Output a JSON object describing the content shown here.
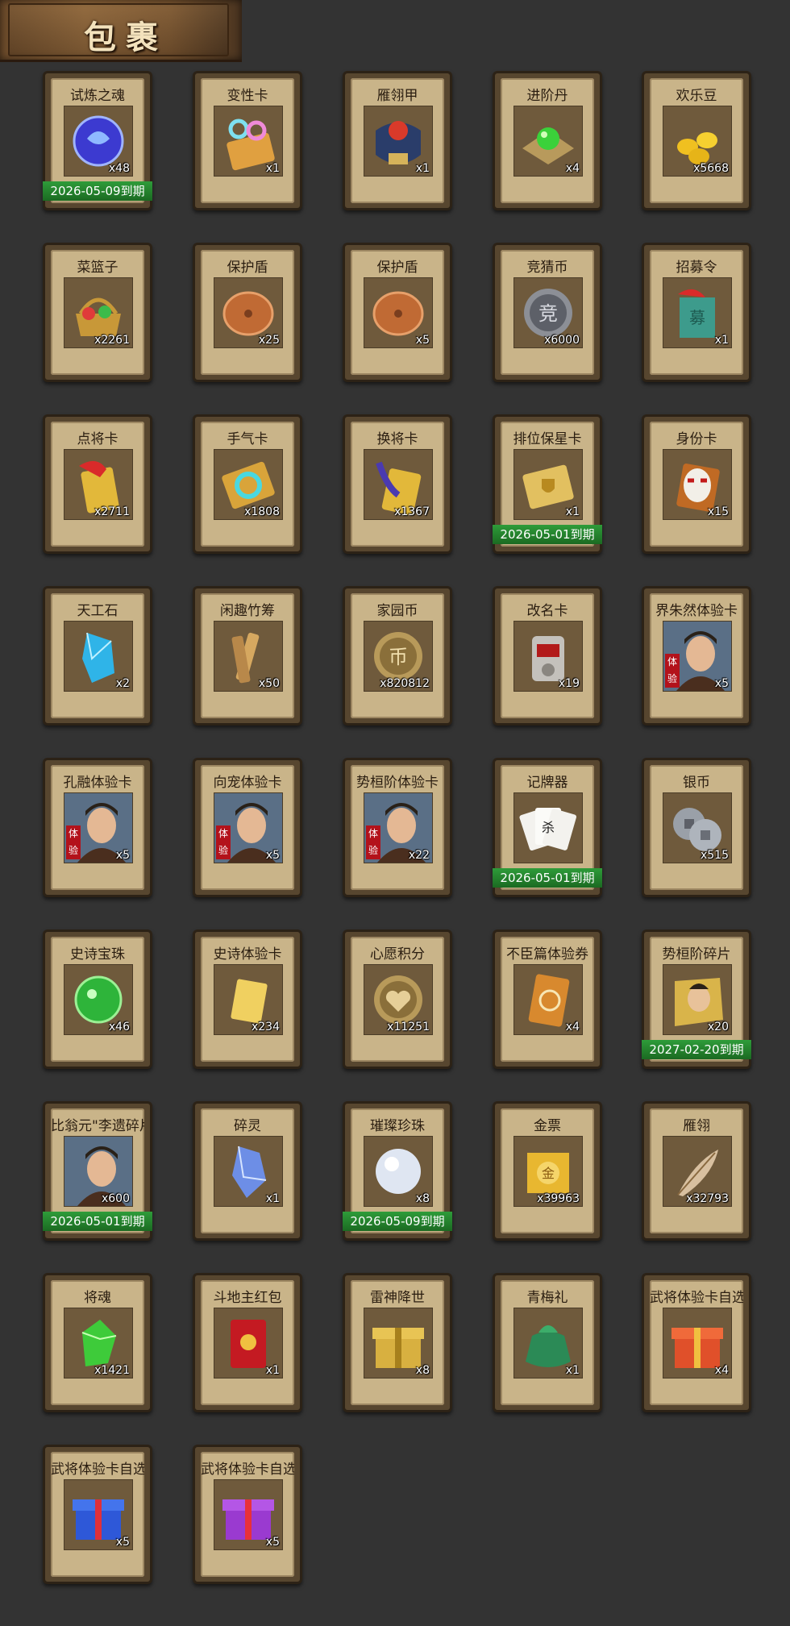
{
  "header": {
    "title": "包裹"
  },
  "items": [
    {
      "name": "试炼之魂",
      "count": "x48",
      "expiry": "2026-05-09到期",
      "icon": "blue-orb-icon"
    },
    {
      "name": "变性卡",
      "count": "x1",
      "expiry": "",
      "icon": "gender-card-icon"
    },
    {
      "name": "雁翎甲",
      "count": "x1",
      "expiry": "",
      "icon": "armor-icon"
    },
    {
      "name": "进阶丹",
      "count": "x4",
      "expiry": "",
      "icon": "green-pill-icon"
    },
    {
      "name": "欢乐豆",
      "count": "x5668",
      "expiry": "",
      "icon": "gold-beans-icon"
    },
    {
      "name": "菜篮子",
      "count": "x2261",
      "expiry": "",
      "icon": "basket-icon"
    },
    {
      "name": "保护盾",
      "count": "x25",
      "expiry": "",
      "icon": "shield-icon"
    },
    {
      "name": "保护盾",
      "count": "x5",
      "expiry": "",
      "icon": "shield-icon"
    },
    {
      "name": "竞猜币",
      "count": "x6000",
      "expiry": "",
      "icon": "silver-coin-icon"
    },
    {
      "name": "招募令",
      "count": "x1",
      "expiry": "",
      "icon": "jade-token-icon"
    },
    {
      "name": "点将卡",
      "count": "x2711",
      "expiry": "",
      "icon": "general-card-icon"
    },
    {
      "name": "手气卡",
      "count": "x1808",
      "expiry": "",
      "icon": "luck-card-icon"
    },
    {
      "name": "换将卡",
      "count": "x1367",
      "expiry": "",
      "icon": "swap-card-icon"
    },
    {
      "name": "排位保星卡",
      "count": "x1",
      "expiry": "2026-05-01到期",
      "icon": "rank-card-icon"
    },
    {
      "name": "身份卡",
      "count": "x15",
      "expiry": "",
      "icon": "identity-mask-icon"
    },
    {
      "name": "天工石",
      "count": "x2",
      "expiry": "",
      "icon": "crystal-icon"
    },
    {
      "name": "闲趣竹筹",
      "count": "x50",
      "expiry": "",
      "icon": "bamboo-tally-icon"
    },
    {
      "name": "家园币",
      "count": "x820812",
      "expiry": "",
      "icon": "gold-coin-icon"
    },
    {
      "name": "改名卡",
      "count": "x19",
      "expiry": "",
      "icon": "rename-seal-icon"
    },
    {
      "name": "界朱然体验卡",
      "count": "x5",
      "expiry": "",
      "icon": "hero-portrait-icon",
      "trial": "体验"
    },
    {
      "name": "孔融体验卡",
      "count": "x5",
      "expiry": "",
      "icon": "hero-portrait-icon",
      "trial": "体验"
    },
    {
      "name": "向宠体验卡",
      "count": "x5",
      "expiry": "",
      "icon": "hero-portrait-icon",
      "trial": "体验"
    },
    {
      "name": "势桓阶体验卡",
      "count": "x22",
      "expiry": "",
      "icon": "hero-portrait-icon",
      "trial": "体验"
    },
    {
      "name": "记牌器",
      "count": "",
      "expiry": "2026-05-01到期",
      "icon": "playing-cards-icon"
    },
    {
      "name": "银币",
      "count": "x515",
      "expiry": "",
      "icon": "silver-coins-icon"
    },
    {
      "name": "史诗宝珠",
      "count": "x46",
      "expiry": "",
      "icon": "green-orb-icon"
    },
    {
      "name": "史诗体验卡",
      "count": "x234",
      "expiry": "",
      "icon": "gold-card-icon"
    },
    {
      "name": "心愿积分",
      "count": "x11251",
      "expiry": "",
      "icon": "heart-coin-icon"
    },
    {
      "name": "不臣篇体验券",
      "count": "x4",
      "expiry": "",
      "icon": "ticket-card-icon"
    },
    {
      "name": "势桓阶碎片",
      "count": "x20",
      "expiry": "2027-02-20到期",
      "icon": "hero-fragment-icon"
    },
    {
      "name": "比翁元\"李遗碎片",
      "count": "x600",
      "expiry": "2026-05-01到期",
      "icon": "hero-portrait-icon"
    },
    {
      "name": "碎灵",
      "count": "x1",
      "expiry": "",
      "icon": "shard-icon"
    },
    {
      "name": "璀璨珍珠",
      "count": "x8",
      "expiry": "2026-05-09到期",
      "icon": "pearl-icon"
    },
    {
      "name": "金票",
      "count": "x39963",
      "expiry": "",
      "icon": "gold-ticket-icon"
    },
    {
      "name": "雁翎",
      "count": "x32793",
      "expiry": "",
      "icon": "feather-icon"
    },
    {
      "name": "将魂",
      "count": "x1421",
      "expiry": "",
      "icon": "green-gem-icon"
    },
    {
      "name": "斗地主红包",
      "count": "x1",
      "expiry": "",
      "icon": "red-envelope-icon"
    },
    {
      "name": "雷神降世",
      "count": "x8",
      "expiry": "",
      "icon": "gold-giftbox-icon"
    },
    {
      "name": "青梅礼",
      "count": "x1",
      "expiry": "",
      "icon": "green-bag-icon"
    },
    {
      "name": "武将体验卡自选",
      "count": "x4",
      "expiry": "",
      "icon": "red-giftbox-icon"
    },
    {
      "name": "武将体验卡自选",
      "count": "x5",
      "expiry": "",
      "icon": "blue-giftbox-icon"
    },
    {
      "name": "武将体验卡自选",
      "count": "x5",
      "expiry": "",
      "icon": "purple-giftbox-icon"
    }
  ]
}
